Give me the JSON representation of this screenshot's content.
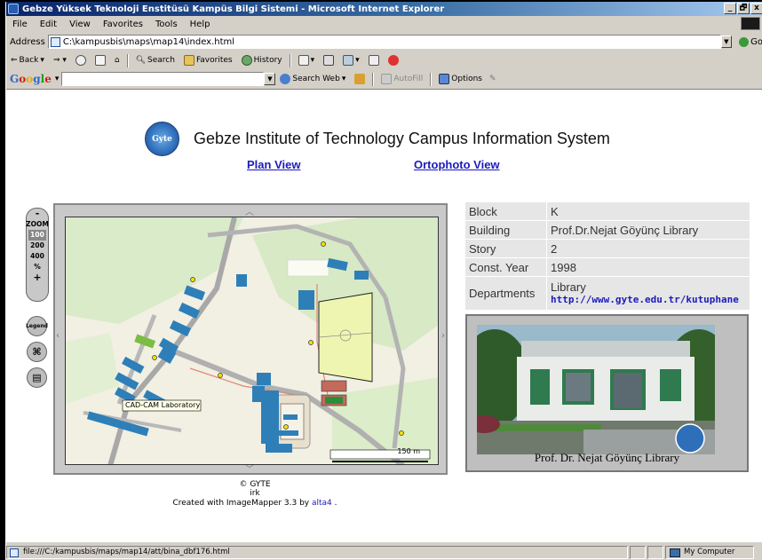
{
  "window": {
    "title": "Gebze Yüksek Teknoloji Enstitüsü Kampüs Bilgi Sistemi - Microsoft Internet Explorer",
    "controls": [
      "_",
      "🗗",
      "x"
    ]
  },
  "menu": [
    "File",
    "Edit",
    "View",
    "Favorites",
    "Tools",
    "Help"
  ],
  "address": {
    "label": "Address",
    "url": "C:\\kampusbis\\maps\\map14\\index.html",
    "go_label": "Go"
  },
  "toolbar": {
    "back": "Back",
    "search": "Search",
    "favorites": "Favorites",
    "history": "History"
  },
  "google_bar": {
    "logo": "Google",
    "search_web": "Search Web",
    "autofill": "AutoFill",
    "options": "Options"
  },
  "page": {
    "logo_text": "Gyte",
    "title": "Gebze Institute of Technology Campus Information System",
    "plan_view": "Plan View",
    "ortophoto_view": "Ortophoto View"
  },
  "zoom_control": {
    "minus": "-",
    "label": "ZOOM",
    "levels": [
      "100",
      "200",
      "400"
    ],
    "selected": "100",
    "percent": "%",
    "plus": "+"
  },
  "map": {
    "tooltip": "CAD-CAM Laboratory",
    "scale": "150 m",
    "legend_label": "Legend"
  },
  "credits": {
    "copyright": "© GYTE",
    "author": "irk",
    "created_prefix": "Created with ImageMapper 3.3 by",
    "created_link": "alta4",
    "created_suffix": "."
  },
  "info": {
    "rows": [
      {
        "label": "Block",
        "value": "K"
      },
      {
        "label": "Building",
        "value": "Prof.Dr.Nejat Göyünç Library"
      },
      {
        "label": "Story",
        "value": "2"
      },
      {
        "label": "Const. Year",
        "value": "1998"
      }
    ],
    "departments_label": "Departments",
    "departments_value": "Library",
    "departments_link": "http://www.gyte.edu.tr/kutuphane"
  },
  "photo": {
    "caption": "Prof. Dr. Nejat Göyünç Library"
  },
  "status": {
    "text": "file:///C:/kampusbis/maps/map14/att/bina_dbf176.html",
    "zone": "My Computer"
  },
  "colors": {
    "title_bar": "#0a246a",
    "link": "#1b1bbd",
    "building": "#2e7fb8",
    "sports_field": "#eef5b0"
  }
}
